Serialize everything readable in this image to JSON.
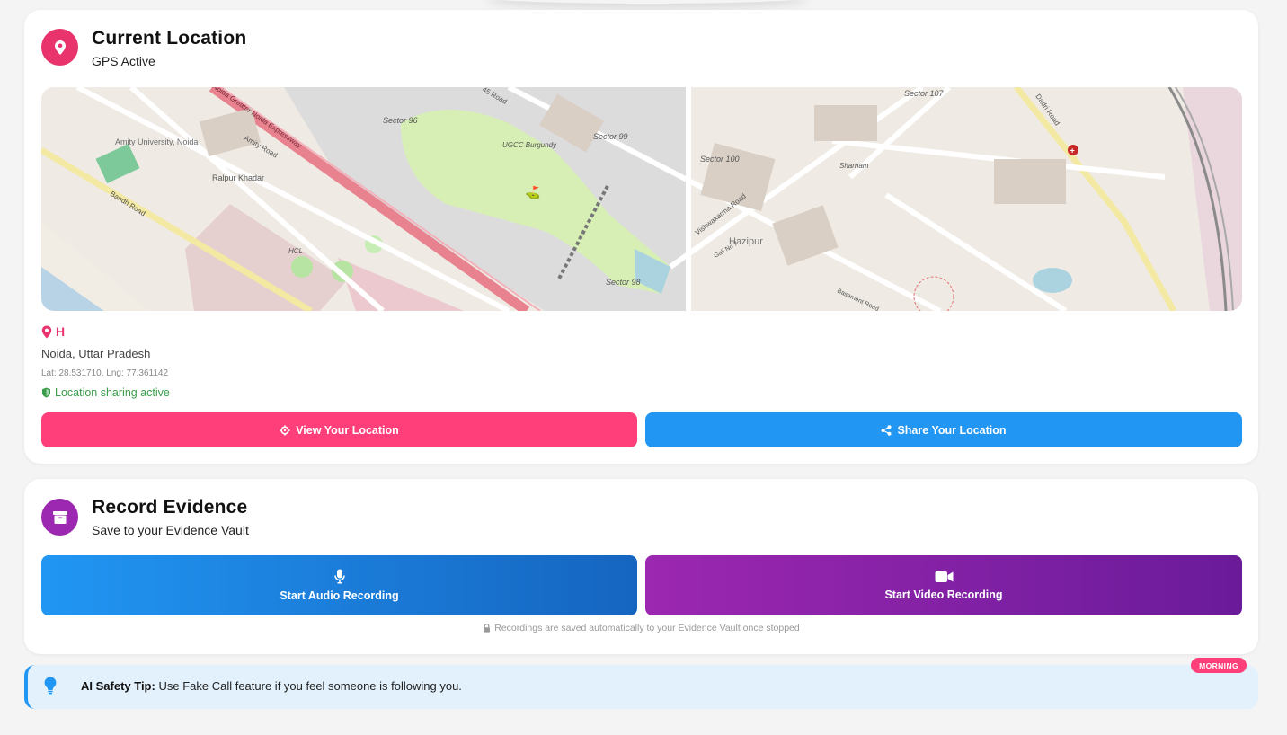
{
  "location_card": {
    "title": "Current Location",
    "subtitle": "GPS Active",
    "place_name": "H",
    "city": "Noida, Uttar Pradesh",
    "coords": "Lat: 28.531710, Lng: 77.361142",
    "sharing_status": "Location sharing active",
    "view_button": "View Your Location",
    "share_button": "Share Your Location",
    "icon": "map-pin-icon",
    "accent_color": "#e8336d"
  },
  "map": {
    "labels": {
      "expressway": "Noida Greater Noida Expressway",
      "amity_university": "Amity University, Noida",
      "amity_road": "Amity Road",
      "ralpur_khadar": "Ralpur Khadar",
      "bandh_road": "Bandh Road",
      "sector_96": "Sector 96",
      "ugcc": "UGCC Burgundy",
      "sector_99": "Sector 99",
      "sector_100": "Sector 100",
      "sector_98": "Sector 98",
      "sector_107": "Sector 107",
      "road_45": "45 Road",
      "vishwakarma_road": "Vishwakarma Road",
      "hazipur": "Hazipur",
      "sharnam": "Sharnam",
      "dadri_road": "Dadri Road",
      "hcl": "HCL",
      "gali": "Gali No 7",
      "basement": "Basement Road"
    }
  },
  "record_card": {
    "title": "Record Evidence",
    "subtitle": "Save to your Evidence Vault",
    "audio_button": "Start Audio Recording",
    "video_button": "Start Video Recording",
    "note": "Recordings are saved automatically to your Evidence Vault once stopped",
    "icon": "archive-icon",
    "accent_color": "#9c27b0"
  },
  "tip": {
    "label": "AI Safety Tip:",
    "text": "Use Fake Call feature if you feel someone is following you.",
    "badge": "MORNING",
    "icon": "lightbulb-icon"
  }
}
